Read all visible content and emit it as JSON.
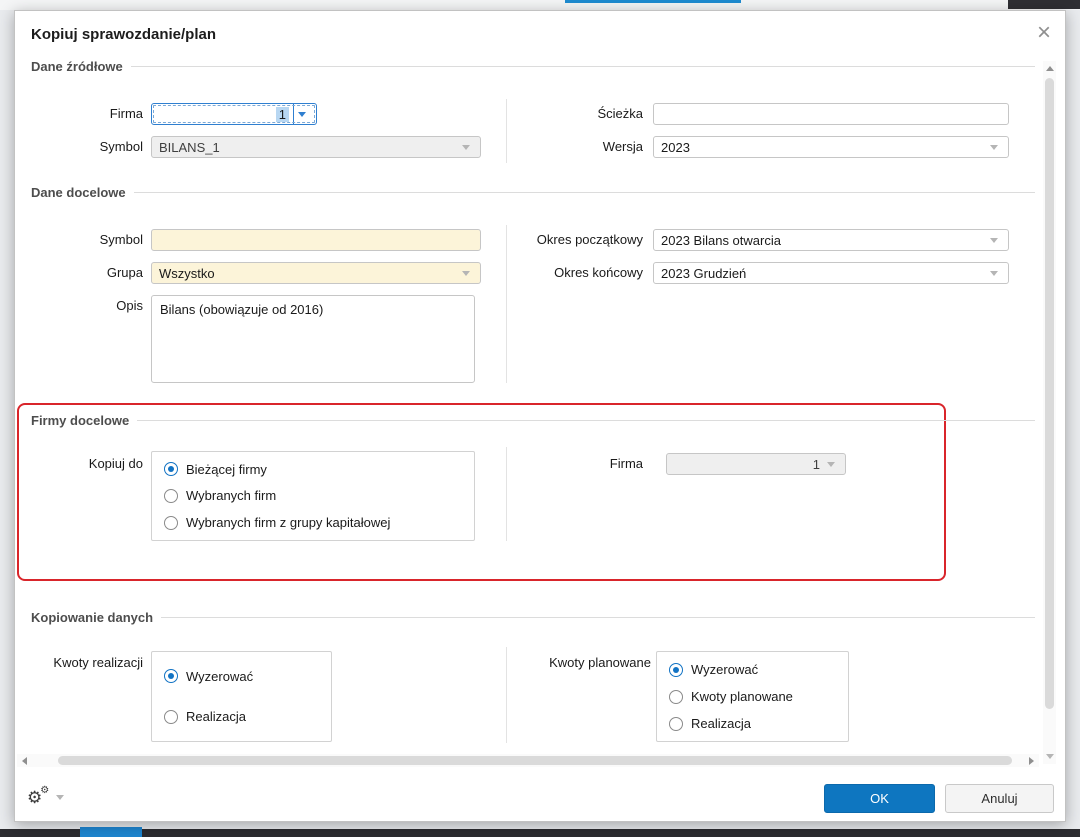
{
  "window": {
    "title": "Kopiuj sprawozdanie/plan",
    "close_glyph": "×"
  },
  "sections": {
    "source": "Dane źródłowe",
    "target": "Dane docelowe",
    "companies": "Firmy docelowe",
    "copy": "Kopiowanie danych"
  },
  "source": {
    "firma": {
      "label": "Firma",
      "value": "1"
    },
    "symbol": {
      "label": "Symbol",
      "value": "BILANS_1"
    },
    "sciezka": {
      "label": "Ścieżka",
      "value": ""
    },
    "wersja": {
      "label": "Wersja",
      "value": "2023"
    }
  },
  "target": {
    "symbol": {
      "label": "Symbol",
      "value": ""
    },
    "grupa": {
      "label": "Grupa",
      "value": "Wszystko"
    },
    "opis": {
      "label": "Opis",
      "value": "Bilans (obowiązuje od 2016)"
    },
    "okres_poczatkowy": {
      "label": "Okres początkowy",
      "value": "2023 Bilans otwarcia"
    },
    "okres_koncowy": {
      "label": "Okres końcowy",
      "value": "2023 Grudzień"
    }
  },
  "target_companies": {
    "kopiuj_do_label": "Kopiuj do",
    "options": [
      "Bieżącej firmy",
      "Wybranych firm",
      "Wybranych firm z grupy kapitałowej"
    ],
    "selected": "Bieżącej firmy",
    "firma": {
      "label": "Firma",
      "value": "1"
    }
  },
  "copy_data": {
    "kwoty_realizacji": {
      "label": "Kwoty realizacji",
      "options": [
        "Wyzerować",
        "Realizacja"
      ],
      "selected": "Wyzerować"
    },
    "kwoty_planowane": {
      "label": "Kwoty planowane",
      "options": [
        "Wyzerować",
        "Kwoty planowane",
        "Realizacja"
      ],
      "selected": "Wyzerować"
    }
  },
  "footer": {
    "ok_label": "OK",
    "cancel_label": "Anuluj"
  },
  "icons": {
    "settings": "⚙"
  },
  "colors": {
    "accent_blue": "#0e76c0",
    "annotation_red": "#d9252b",
    "cream": "#fcf4d9",
    "focus_blue": "#2f7fd0"
  }
}
